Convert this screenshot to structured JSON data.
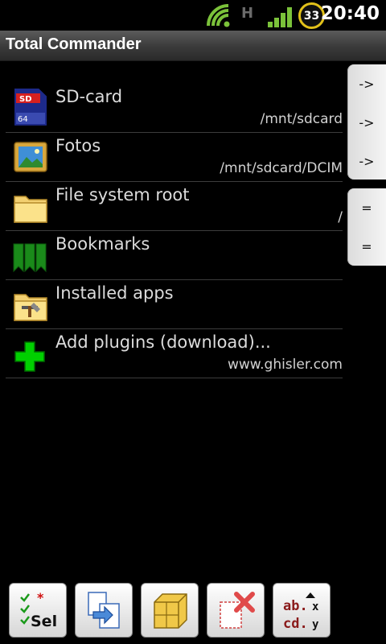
{
  "status": {
    "network_label": "H",
    "battery": "33",
    "time": "20:40"
  },
  "app": {
    "title": "Total Commander"
  },
  "items": [
    {
      "name": "SD-card",
      "path": "/mnt/sdcard",
      "icon": "sd-card-icon"
    },
    {
      "name": "Fotos",
      "path": "/mnt/sdcard/DCIM",
      "icon": "photo-folder-icon"
    },
    {
      "name": "File system root",
      "path": "/",
      "icon": "folder-icon"
    },
    {
      "name": "Bookmarks",
      "path": "",
      "icon": "bookmarks-icon"
    },
    {
      "name": "Installed apps",
      "path": "",
      "icon": "apps-folder-icon"
    },
    {
      "name": "Add plugins (download)...",
      "path": "www.ghisler.com",
      "icon": "add-plugin-icon"
    }
  ],
  "side_buttons": {
    "group1": [
      "->",
      "->",
      "->"
    ],
    "group2": [
      "=",
      "="
    ]
  },
  "toolbar": [
    {
      "name": "select-button",
      "icon": "select-icon"
    },
    {
      "name": "copy-move-button",
      "icon": "copy-move-icon"
    },
    {
      "name": "pack-button",
      "icon": "pack-icon"
    },
    {
      "name": "delete-button",
      "icon": "delete-icon"
    },
    {
      "name": "sort-button",
      "icon": "sort-icon"
    }
  ],
  "colors": {
    "background": "#000000",
    "title_bar": "#3a3a3a",
    "separator": "#3c3c3c",
    "plus_green": "#00d000"
  }
}
